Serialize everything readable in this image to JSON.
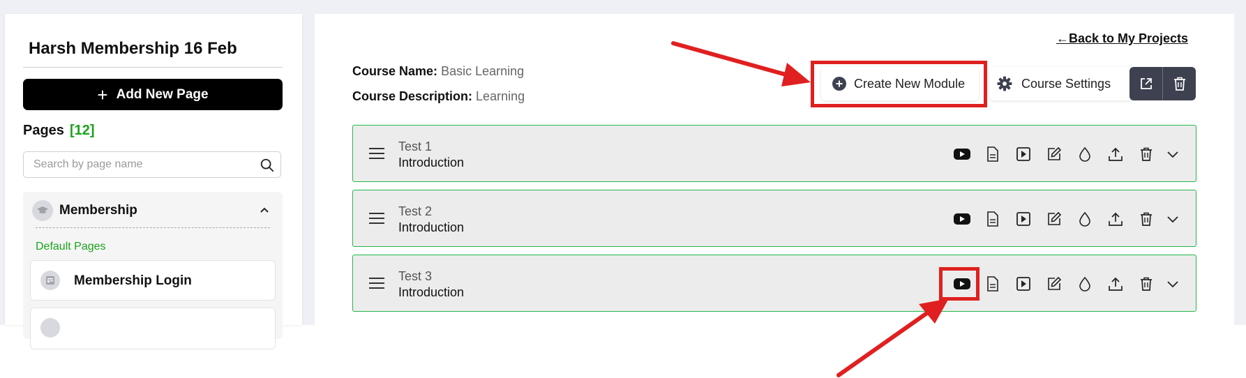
{
  "sidebar": {
    "project_title": "Harsh Membership 16 Feb",
    "add_page_label": "Add New Page",
    "pages_label": "Pages",
    "pages_count": "[12]",
    "search_placeholder": "Search by page name",
    "group": {
      "name": "Membership",
      "section_label": "Default Pages",
      "pages": [
        {
          "label": "Membership Login"
        }
      ]
    }
  },
  "main": {
    "back_link": "Back to My Projects",
    "course_name_label": "Course Name:",
    "course_name_value": "Basic Learning",
    "course_desc_label": "Course Description:",
    "course_desc_value": "Learning",
    "create_module_label": "Create New Module",
    "course_settings_label": "Course Settings",
    "modules": [
      {
        "title": "Test 1",
        "subtitle": "Introduction"
      },
      {
        "title": "Test 2",
        "subtitle": "Introduction"
      },
      {
        "title": "Test 3",
        "subtitle": "Introduction"
      }
    ],
    "module_tools": [
      "youtube-icon",
      "document-icon",
      "play-icon",
      "edit-icon",
      "drop-icon",
      "upload-icon",
      "trash-icon",
      "chevron-down-icon"
    ]
  },
  "colors": {
    "accent_green": "#1aa31a",
    "module_border": "#22b84a",
    "annotation_red": "#e02020",
    "dark_button": "#3d4150"
  }
}
